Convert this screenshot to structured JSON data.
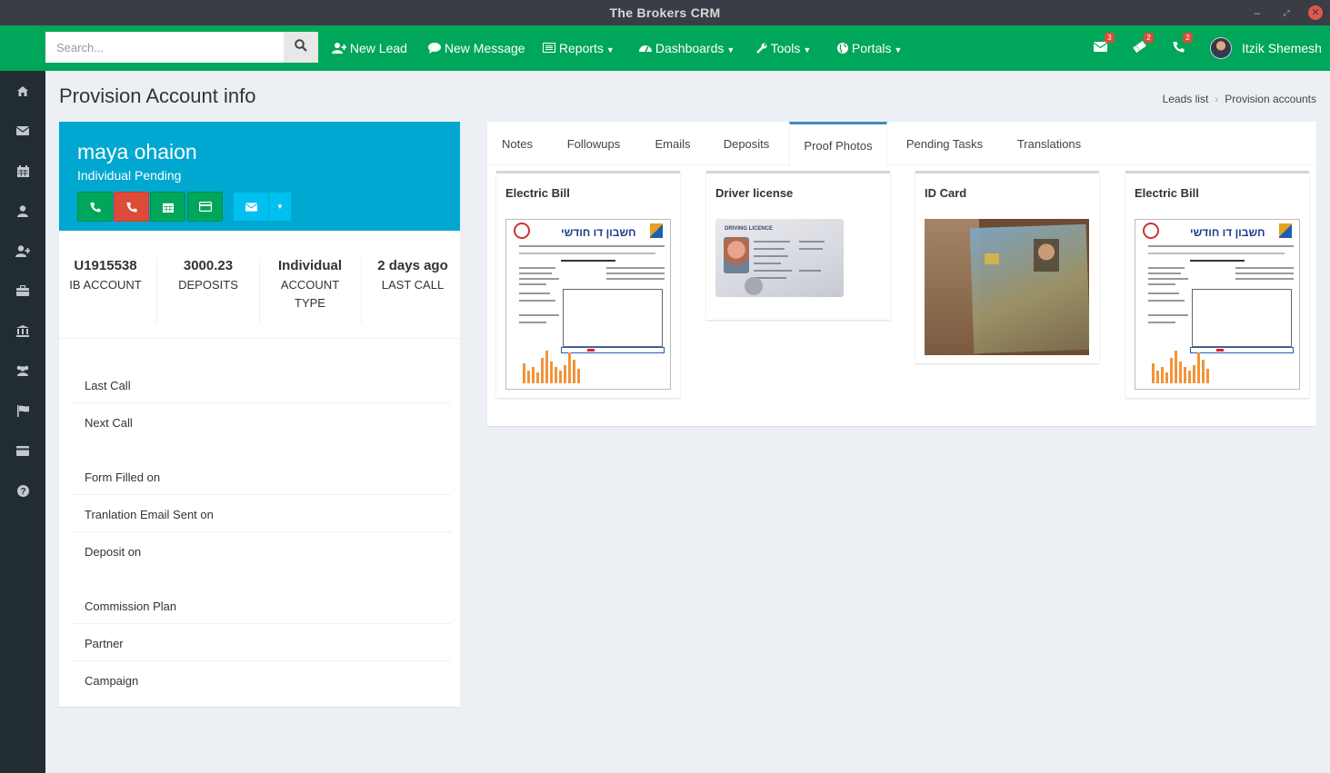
{
  "window": {
    "title": "The Brokers CRM"
  },
  "search": {
    "placeholder": "Search..."
  },
  "nav": {
    "new_lead": "New Lead",
    "new_message": "New Message",
    "reports": "Reports",
    "dashboards": "Dashboards",
    "tools": "Tools",
    "portals": "Portals",
    "mail_badge": "3",
    "tickets_badge": "2",
    "calls_badge": "2",
    "user_name": "Itzik Shemesh"
  },
  "sidebar": {
    "items": [
      "home-icon",
      "envelope-icon",
      "calendar-icon",
      "user-icon",
      "user-plus-icon",
      "briefcase-icon",
      "bank-icon",
      "users-icon",
      "flag-icon",
      "credit-card-icon",
      "question-icon"
    ]
  },
  "page": {
    "title": "Provision Account info",
    "breadcrumb": [
      "Leads list",
      "Provision accounts"
    ]
  },
  "profile": {
    "name": "maya ohaion",
    "status": "Individual Pending",
    "colors": {
      "header": "#00a7d0",
      "green": "#00a65a",
      "red": "#dd4b39",
      "blue": "#00c0ef"
    },
    "stats": [
      {
        "value": "U1915538",
        "label": "IB ACCOUNT"
      },
      {
        "value": "3000.23",
        "label": "DEPOSITS"
      },
      {
        "value": "Individual",
        "label": "ACCOUNT TYPE"
      },
      {
        "value": "2 days ago",
        "label": "LAST CALL"
      }
    ],
    "fields": {
      "last_call": "Last Call",
      "next_call": "Next Call",
      "form_filled": "Form Filled on",
      "translation_email": "Tranlation Email Sent on",
      "deposit_on": "Deposit on",
      "commission_plan": "Commission Plan",
      "partner": "Partner",
      "campaign": "Campaign"
    }
  },
  "tabs": [
    "Notes",
    "Followups",
    "Emails",
    "Deposits",
    "Proof Photos",
    "Pending Tasks",
    "Translations"
  ],
  "active_tab": "Proof Photos",
  "photos": [
    {
      "title": "Electric Bill"
    },
    {
      "title": "Driver license"
    },
    {
      "title": "ID Card"
    },
    {
      "title": "Electric Bill"
    }
  ],
  "thumb_text": {
    "bill_header": "חשבון דו חודשי",
    "license_header": "DRIVING LICENCE"
  }
}
